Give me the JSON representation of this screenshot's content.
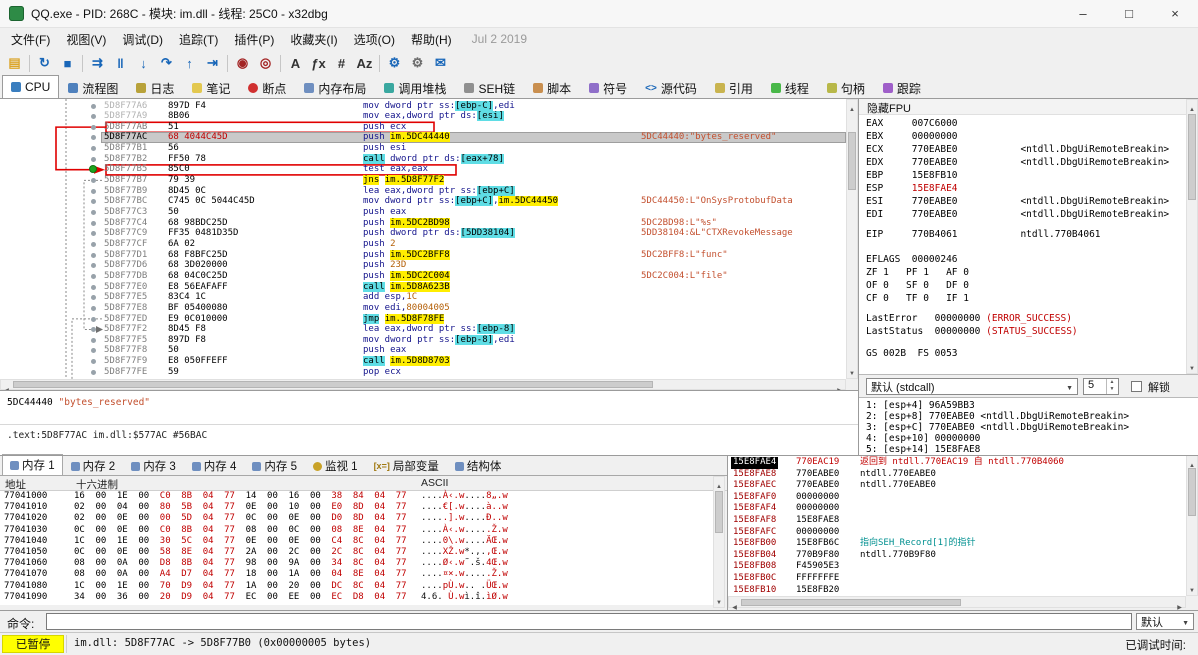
{
  "window": {
    "title": "QQ.exe - PID: 268C - 模块: im.dll - 线程: 25C0 - x32dbg",
    "controls": {
      "minimize": "–",
      "maximize": "□",
      "close": "×"
    }
  },
  "menubar": {
    "items": [
      {
        "label": "文件(F)",
        "key": "file"
      },
      {
        "label": "视图(V)",
        "key": "view"
      },
      {
        "label": "调试(D)",
        "key": "debug"
      },
      {
        "label": "追踪(T)",
        "key": "trace"
      },
      {
        "label": "插件(P)",
        "key": "plugins"
      },
      {
        "label": "收藏夹(I)",
        "key": "favourites"
      },
      {
        "label": "选项(O)",
        "key": "options"
      },
      {
        "label": "帮助(H)",
        "key": "help"
      }
    ],
    "build_date": "Jul 2 2019"
  },
  "toolbar": {
    "buttons": [
      {
        "name": "open-file",
        "glyph": "▤",
        "color": "#dba62b"
      },
      {
        "sep": true
      },
      {
        "name": "restart",
        "glyph": "↻",
        "color": "#1866b8"
      },
      {
        "name": "stop",
        "glyph": "■",
        "color": "#1866b8"
      },
      {
        "sep": true
      },
      {
        "name": "run",
        "glyph": "⇉",
        "color": "#1866b8"
      },
      {
        "name": "pause",
        "glyph": "‖",
        "color": "#1866b8"
      },
      {
        "name": "step-into",
        "glyph": "↓",
        "color": "#1866b8"
      },
      {
        "name": "step-over",
        "glyph": "↷",
        "color": "#1866b8"
      },
      {
        "name": "step-out",
        "glyph": "↑",
        "color": "#1866b8"
      },
      {
        "name": "run-to-user-code",
        "glyph": "⇥",
        "color": "#1866b8"
      },
      {
        "sep": true
      },
      {
        "name": "trace-into",
        "glyph": "◉",
        "color": "#a32424"
      },
      {
        "name": "trace-over",
        "glyph": "◎",
        "color": "#a32424"
      },
      {
        "sep": true
      },
      {
        "name": "assemble",
        "glyph": "A",
        "color": "#333333"
      },
      {
        "name": "functions",
        "glyph": "ƒx",
        "color": "#333333"
      },
      {
        "name": "patches",
        "glyph": "#",
        "color": "#333333"
      },
      {
        "name": "strings",
        "glyph": "Az",
        "color": "#333333"
      },
      {
        "sep": true
      },
      {
        "name": "settings",
        "glyph": "⚙",
        "color": "#1866b8"
      },
      {
        "name": "appearance",
        "glyph": "⚙",
        "color": "#6a6a6a"
      },
      {
        "name": "chat",
        "glyph": "✉",
        "color": "#1866b8"
      }
    ]
  },
  "tabbar": {
    "tabs": [
      {
        "label": "CPU",
        "key": "cpu",
        "selected": true,
        "icon": "#3a7ebf"
      },
      {
        "label": "流程图",
        "key": "graph",
        "icon": "#4f81bd"
      },
      {
        "label": "日志",
        "key": "log",
        "icon": "#b8a23a"
      },
      {
        "label": "笔记",
        "key": "notes",
        "icon": "#e3c84f"
      },
      {
        "label": "断点",
        "key": "breakpoints",
        "icon": "#d03030",
        "round": true
      },
      {
        "label": "内存布局",
        "key": "memory-map",
        "icon": "#6f8fc0"
      },
      {
        "label": "调用堆栈",
        "key": "call-stack",
        "icon": "#3aa8a0"
      },
      {
        "label": "SEH链",
        "key": "seh",
        "icon": "#909090"
      },
      {
        "label": "脚本",
        "key": "script",
        "icon": "#c98f4f"
      },
      {
        "label": "符号",
        "key": "symbols",
        "icon": "#8f6fc9"
      },
      {
        "label": "源代码",
        "key": "source",
        "icon": "#1866b8",
        "icon_text": "<>"
      },
      {
        "label": "引用",
        "key": "references",
        "icon": "#c9b44f"
      },
      {
        "label": "线程",
        "key": "threads",
        "icon": "#49b849"
      },
      {
        "label": "句柄",
        "key": "handles",
        "icon": "#b8b849"
      },
      {
        "label": "跟踪",
        "key": "trace-view",
        "icon": "#9f5fc9"
      }
    ]
  },
  "disasm": {
    "rows": [
      {
        "a": "5D8F77A6",
        "dim": 1,
        "b": "897D F4",
        "t": [
          [
            "mov dword ptr ss:",
            "n"
          ],
          [
            "[ebp-C]",
            "m"
          ],
          [
            ",edi",
            "n"
          ]
        ]
      },
      {
        "a": "5D8F77A9",
        "dim": 1,
        "b": "8B06",
        "t": [
          [
            "mov eax,dword ptr ds:",
            "n"
          ],
          [
            "[esi]",
            "m"
          ]
        ]
      },
      {
        "a": "5D8F77AB",
        "b": "51",
        "t": [
          [
            "push ecx",
            "n"
          ]
        ]
      },
      {
        "a": "5D8F77AC",
        "sel": 1,
        "bred": 1,
        "b": "68 4044C45D",
        "t": [
          [
            "push ",
            "n"
          ],
          [
            "im.5DC44440",
            "y"
          ]
        ],
        "c": "5DC44440:\"bytes_reserved\""
      },
      {
        "a": "5D8F77B1",
        "b": "56",
        "t": [
          [
            "push esi",
            "n"
          ]
        ]
      },
      {
        "a": "5D8F77B2",
        "b": "FF50 78",
        "t": [
          [
            "call",
            "c"
          ],
          [
            " dword ptr ds:",
            "n"
          ],
          [
            "[eax+78]",
            "m"
          ]
        ]
      },
      {
        "a": "5D8F77B5",
        "dot": "green",
        "b": "85C0",
        "t": [
          [
            "test eax,eax",
            "n"
          ]
        ]
      },
      {
        "a": "5D8F77B7",
        "b": "79 39",
        "t": [
          [
            "jns",
            "y"
          ],
          [
            " ",
            "n"
          ],
          [
            "im.5D8F77F2",
            "y"
          ]
        ]
      },
      {
        "a": "5D8F77B9",
        "b": "8D45 0C",
        "t": [
          [
            "lea eax,dword ptr ss:",
            "n"
          ],
          [
            "[ebp+C]",
            "m"
          ]
        ]
      },
      {
        "a": "5D8F77BC",
        "b": "C745 0C 5044C45D",
        "t": [
          [
            "mov dword ptr ss:",
            "n"
          ],
          [
            "[ebp+C]",
            "m"
          ],
          [
            ",",
            "n"
          ],
          [
            "im.5DC44450",
            "y"
          ]
        ],
        "c": "5DC44450:L\"OnSysProtobufData"
      },
      {
        "a": "5D8F77C3",
        "b": "50",
        "t": [
          [
            "push eax",
            "n"
          ]
        ]
      },
      {
        "a": "5D8F77C4",
        "b": "68 98BDC25D",
        "t": [
          [
            "push ",
            "n"
          ],
          [
            "im.5DC2BD98",
            "y"
          ]
        ],
        "c": "5DC2BD98:L\"%s\""
      },
      {
        "a": "5D8F77C9",
        "b": "FF35 0481D35D",
        "t": [
          [
            "push dword ptr ds:",
            "n"
          ],
          [
            "[5DD38104]",
            "m"
          ]
        ],
        "c": "5DD38104:&L\"CTXRevokeMessage"
      },
      {
        "a": "5D8F77CF",
        "b": "6A 02",
        "t": [
          [
            "push ",
            "n"
          ],
          [
            "2",
            "i"
          ]
        ]
      },
      {
        "a": "5D8F77D1",
        "b": "68 F8BFC25D",
        "t": [
          [
            "push ",
            "n"
          ],
          [
            "im.5DC2BFF8",
            "y"
          ]
        ],
        "c": "5DC2BFF8:L\"func\""
      },
      {
        "a": "5D8F77D6",
        "b": "68 3D020000",
        "t": [
          [
            "push ",
            "n"
          ],
          [
            "23D",
            "i"
          ]
        ]
      },
      {
        "a": "5D8F77DB",
        "b": "68 04C0C25D",
        "t": [
          [
            "push ",
            "n"
          ],
          [
            "im.5DC2C004",
            "y"
          ]
        ],
        "c": "5DC2C004:L\"file\""
      },
      {
        "a": "5D8F77E0",
        "b": "E8 56EAFAFF",
        "t": [
          [
            "call",
            "c"
          ],
          [
            " ",
            "n"
          ],
          [
            "im.5D8A623B",
            "y"
          ]
        ]
      },
      {
        "a": "5D8F77E5",
        "b": "83C4 1C",
        "t": [
          [
            "add esp,",
            "n"
          ],
          [
            "1C",
            "i"
          ]
        ]
      },
      {
        "a": "5D8F77E8",
        "b": "BF 05400080",
        "t": [
          [
            "mov edi,",
            "n"
          ],
          [
            "80004005",
            "i"
          ]
        ]
      },
      {
        "a": "5D8F77ED",
        "b": "E9 0C010000",
        "t": [
          [
            "jmp",
            "c"
          ],
          [
            " ",
            "n"
          ],
          [
            "im.5D8F78FE",
            "y"
          ]
        ]
      },
      {
        "a": "5D8F77F2",
        "b": "8D45 F8",
        "t": [
          [
            "lea eax,dword ptr ss:",
            "n"
          ],
          [
            "[ebp-8]",
            "m"
          ]
        ]
      },
      {
        "a": "5D8F77F5",
        "b": "897D F8",
        "t": [
          [
            "mov dword ptr ss:",
            "n"
          ],
          [
            "[ebp-8]",
            "m"
          ],
          [
            ",edi",
            "n"
          ]
        ]
      },
      {
        "a": "5D8F77F8",
        "b": "50",
        "t": [
          [
            "push eax",
            "n"
          ]
        ]
      },
      {
        "a": "5D8F77F9",
        "b": "E8 050FFEFF",
        "t": [
          [
            "call",
            "c"
          ],
          [
            " ",
            "n"
          ],
          [
            "im.5D8D8703",
            "y"
          ]
        ]
      },
      {
        "a": "5D8F77FE",
        "b": "59",
        "t": [
          [
            "pop ecx",
            "n"
          ]
        ]
      }
    ],
    "annotations": {
      "boxed_rows": [
        2,
        6
      ],
      "connector": [
        2,
        6
      ],
      "left_arrow_row": 3
    },
    "jumps": [
      {
        "from": 7,
        "to": 21
      },
      {
        "from": 20,
        "to": null
      }
    ]
  },
  "info_pane": {
    "address": "5DC44440",
    "string": "\"bytes_reserved\"",
    "location": ".text:5D8F77AC im.dll:$577AC #56BAC"
  },
  "registers": {
    "fpu_label": "隐藏FPU",
    "rows": [
      {
        "t": [
          [
            "EAX     ",
            "k"
          ],
          [
            "007C6000",
            "k"
          ]
        ]
      },
      {
        "t": [
          [
            "EBX     ",
            "k"
          ],
          [
            "00000000",
            "k"
          ]
        ]
      },
      {
        "t": [
          [
            "ECX     ",
            "k"
          ],
          [
            "770EABE0",
            "k"
          ],
          [
            "           <ntdll.DbgUiRemoteBreakin>",
            "k"
          ]
        ]
      },
      {
        "t": [
          [
            "EDX     ",
            "k"
          ],
          [
            "770EABE0",
            "k"
          ],
          [
            "           <ntdll.DbgUiRemoteBreakin>",
            "k"
          ]
        ]
      },
      {
        "t": [
          [
            "EBP     ",
            "k"
          ],
          [
            "15E8FB10",
            "k"
          ]
        ]
      },
      {
        "t": [
          [
            "ESP     ",
            "k"
          ],
          [
            "15E8FAE4",
            "r"
          ]
        ]
      },
      {
        "t": [
          [
            "ESI     ",
            "k"
          ],
          [
            "770EABE0",
            "k"
          ],
          [
            "           <ntdll.DbgUiRemoteBreakin>",
            "k"
          ]
        ]
      },
      {
        "t": [
          [
            "EDI     ",
            "k"
          ],
          [
            "770EABE0",
            "k"
          ],
          [
            "           <ntdll.DbgUiRemoteBreakin>",
            "k"
          ]
        ]
      },
      {
        "t": [
          [
            "EIP     ",
            "k"
          ],
          [
            "770B4061",
            "k"
          ],
          [
            "           ntdll.770B4061",
            "k"
          ]
        ]
      },
      {
        "t": [
          [
            "EFLAGS  ",
            "k"
          ],
          [
            "00000246",
            "k"
          ]
        ]
      },
      {
        "t": [
          [
            "ZF 1   PF 1   AF 0",
            "k"
          ]
        ]
      },
      {
        "t": [
          [
            "OF 0   SF 0   DF 0",
            "k"
          ]
        ]
      },
      {
        "t": [
          [
            "CF 0   TF 0   IF 1",
            "k"
          ]
        ]
      },
      {
        "t": [
          [
            "LastError   ",
            "k"
          ],
          [
            "00000000 ",
            "k"
          ],
          [
            "(ERROR_SUCCESS)",
            "r"
          ]
        ]
      },
      {
        "t": [
          [
            "LastStatus  ",
            "k"
          ],
          [
            "00000000 ",
            "k"
          ],
          [
            "(STATUS_SUCCESS)",
            "r"
          ]
        ]
      },
      {
        "t": [
          [
            "GS 002B  FS 0053",
            "k"
          ]
        ]
      }
    ]
  },
  "callconv": {
    "selected": "默认 (stdcall)",
    "count": "5",
    "unlock_label": "解锁"
  },
  "args": {
    "rows": [
      "1: [esp+4] 96A59BB3",
      "2: [esp+8] 770EABE0 <ntdll.DbgUiRemoteBreakin>",
      "3: [esp+C] 770EABE0 <ntdll.DbgUiRemoteBreakin>",
      "4: [esp+10] 00000000",
      "5: [esp+14] 15E8FAE8"
    ]
  },
  "dump": {
    "tabs": [
      {
        "label": "内存 1",
        "key": "memory-1",
        "selected": true,
        "icon": "#6f8fc0"
      },
      {
        "label": "内存 2",
        "key": "memory-2",
        "icon": "#6f8fc0"
      },
      {
        "label": "内存 3",
        "key": "memory-3",
        "icon": "#6f8fc0"
      },
      {
        "label": "内存 4",
        "key": "memory-4",
        "icon": "#6f8fc0"
      },
      {
        "label": "内存 5",
        "key": "memory-5",
        "icon": "#6f8fc0"
      },
      {
        "label": "监视 1",
        "key": "watch-1",
        "icon": "#c9a227",
        "round": true
      },
      {
        "label": "局部变量",
        "key": "locals",
        "icon": "#a07810",
        "icon_text": "[x=]"
      },
      {
        "label": "结构体",
        "key": "struct",
        "icon": "#6f8fc0"
      }
    ],
    "columns": [
      "地址",
      "十六进制",
      "ASCII"
    ],
    "rows": [
      {
        "addr": "77041000",
        "bytes": "16 00 1E 00 C0 8B 04 77 14 00 16 00 38 84 04 77",
        "ascii": [
          "....",
          "À‹.w",
          "....",
          "8„.w"
        ]
      },
      {
        "addr": "77041010",
        "bytes": "02 00 04 00 80 5B 04 77 0E 00 10 00 E0 8D 04 77",
        "ascii": [
          "....",
          "€[.w",
          "....",
          "à..w"
        ]
      },
      {
        "addr": "77041020",
        "bytes": "02 00 0E 00 00 5D 04 77 0C 00 0E 00 D0 8D 04 77",
        "ascii": [
          "....",
          ".].w",
          "....",
          "Ð..w"
        ]
      },
      {
        "addr": "77041030",
        "bytes": "0C 00 0E 00 C0 8B 04 77 08 00 0C 00 08 8E 04 77",
        "ascii": [
          "....",
          "À‹.w",
          "....",
          ".Ž.w"
        ]
      },
      {
        "addr": "77041040",
        "bytes": "1C 00 1E 00 30 5C 04 77 0E 00 0E 00 C4 8C 04 77",
        "ascii": [
          "....",
          "0\\.w",
          "....",
          "ÄŒ.w"
        ]
      },
      {
        "addr": "77041050",
        "bytes": "0C 00 0E 00 58 8E 04 77 2A 00 2C 00 2C 8C 04 77",
        "ascii": [
          "....",
          "XŽ.w",
          "*.,.",
          ",Œ.w"
        ]
      },
      {
        "addr": "77041060",
        "bytes": "08 00 0A 00 D8 8B 04 77 98 00 9A 00 34 8C 04 77",
        "ascii": [
          "....",
          "Ø‹.w",
          "˜.š.",
          "4Œ.w"
        ]
      },
      {
        "addr": "77041070",
        "bytes": "08 00 0A 00 A4 D7 04 77 18 00 1A 00 04 8E 04 77",
        "ascii": [
          "....",
          "¤×.w",
          "....",
          ".Ž.w"
        ]
      },
      {
        "addr": "77041080",
        "bytes": "1C 00 1E 00 70 D9 04 77 1A 00 20 00 DC 8C 04 77",
        "ascii": [
          "....",
          "pÙ.w",
          ".. .",
          "ÜŒ.w"
        ]
      },
      {
        "addr": "77041090",
        "bytes": "34 00 36 00 20 D9 04 77 EC 00 EE 00 EC D8 04 77",
        "ascii": [
          "4.6.",
          " Ù.w",
          "ì.î.",
          "ìØ.w"
        ]
      }
    ]
  },
  "stack": {
    "rows": [
      {
        "addr": "15E8FAE4",
        "csp": true,
        "value": "770EAC19",
        "vred": 1,
        "comment": "返回到 ntdll.770EAC19 自 ntdll.770B4060",
        "cc": "red"
      },
      {
        "addr": "15E8FAE8",
        "value": "770EABE0",
        "comment": "ntdll.770EABE0"
      },
      {
        "addr": "15E8FAEC",
        "value": "770EABE0",
        "comment": "ntdll.770EABE0"
      },
      {
        "addr": "15E8FAF0",
        "value": "00000000"
      },
      {
        "addr": "15E8FAF4",
        "value": "00000000"
      },
      {
        "addr": "15E8FAF8",
        "value": "15E8FAE8"
      },
      {
        "addr": "15E8FAFC",
        "value": "00000000"
      },
      {
        "addr": "15E8FB00",
        "value": "15E8FB6C",
        "comment": "指向SEH_Record[1]的指针",
        "cc": "teal"
      },
      {
        "addr": "15E8FB04",
        "value": "770B9F80",
        "comment": "ntdll.770B9F80"
      },
      {
        "addr": "15E8FB08",
        "value": "F45905E3"
      },
      {
        "addr": "15E8FB0C",
        "value": "FFFFFFFE"
      },
      {
        "addr": "15E8FB10",
        "value": "15E8FB20"
      }
    ]
  },
  "command": {
    "label": "命令:",
    "value": "",
    "dropdown": "默认"
  },
  "status": {
    "state": "已暂停",
    "message": "im.dll: 5D8F77AC -> 5D8F77B0 (0x00000005 bytes)",
    "right": "已调试时间:"
  },
  "colors": {
    "annotation_red": "#e00000",
    "selection": "#c9c9c9",
    "highlight_yellow": "#ffee00",
    "highlight_cyan": "#5fdde5",
    "comment": "#c3502f",
    "paused_badge": "#ffff00",
    "breakpoint_green": "#1ea51e"
  }
}
